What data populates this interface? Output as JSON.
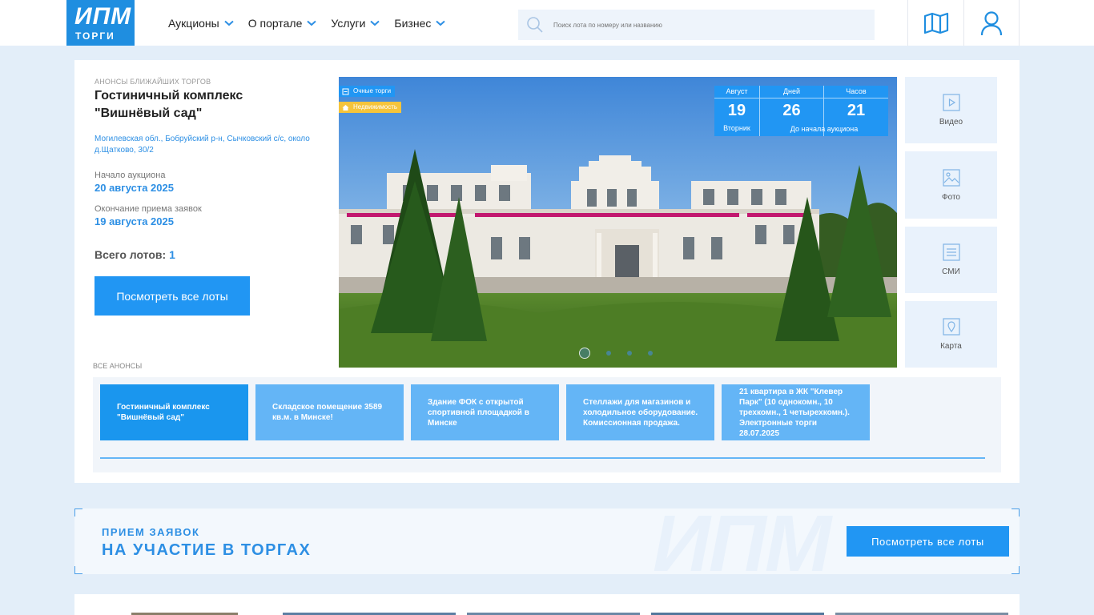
{
  "logo": {
    "big": "ИПМ",
    "small": "ТОРГИ"
  },
  "nav": [
    {
      "label": "Аукционы"
    },
    {
      "label": "О портале"
    },
    {
      "label": "Услуги"
    },
    {
      "label": "Бизнес"
    }
  ],
  "search": {
    "placeholder": "Поиск лота по номеру или названию"
  },
  "header_icons": [
    "map-icon",
    "user-icon"
  ],
  "announcement": {
    "kicker": "Анонсы ближайших торгов",
    "title": "Гостиничный комплекс \"Вишнёвый сад\"",
    "address": "Могилевская обл., Бобруйский р-н, Сычковский с/с, около д.Щатково, 30/2",
    "start_label": "Начало аукциона",
    "start_value": "20 августа 2025",
    "end_label": "Окончание приема заявок",
    "end_value": "19 августа 2025",
    "total_label": "Всего лотов:",
    "total_value": "1",
    "cta_label": "Посмотреть все лоты"
  },
  "slide": {
    "tags": [
      "Очные торги",
      "Недвижимость"
    ],
    "timer": {
      "month_label": "Август",
      "day": "19",
      "weekday": "Вторник",
      "days_label": "Дней",
      "days": "26",
      "hours_label": "Часов",
      "hours": "21",
      "footer": "До начала аукциона"
    },
    "dots_count": 4,
    "active_dot": 0
  },
  "media": [
    {
      "label": "Видео",
      "icon": "play-icon"
    },
    {
      "label": "Фото",
      "icon": "photo-icon"
    },
    {
      "label": "СМИ",
      "icon": "document-icon"
    },
    {
      "label": "Карта",
      "icon": "map-pin-icon"
    }
  ],
  "all_announcements_label": "Все анонсы",
  "announcements": [
    {
      "title": "Гостиничный комплекс \"Вишнёвый сад\"",
      "active": true
    },
    {
      "title": "Складское помещение 3589 кв.м. в Минске!",
      "active": false
    },
    {
      "title": "Здание ФОК с открытой спортивной площадкой в Минске",
      "active": false
    },
    {
      "title": "Стеллажи для магазинов и холодильное оборудование. Комиссионная продажа.",
      "active": false
    },
    {
      "title": "21 квартира в ЖК \"Клевер Парк\" (10 однокомн., 10 трехкомн., 1 четырехкомн.). Электронные торги 28.07.2025",
      "active": false
    }
  ],
  "banner": {
    "kicker": "ПРИЕМ ЗАЯВОК",
    "title": "НА УЧАСТИЕ В ТОРГАХ",
    "watermark": "ИПМ",
    "button": "Посмотреть все лоты"
  },
  "colors": {
    "accent": "#2196f3",
    "light_accent": "#64b5f6",
    "background": "#e3eef9",
    "tag_yellow": "#f5c43b"
  }
}
